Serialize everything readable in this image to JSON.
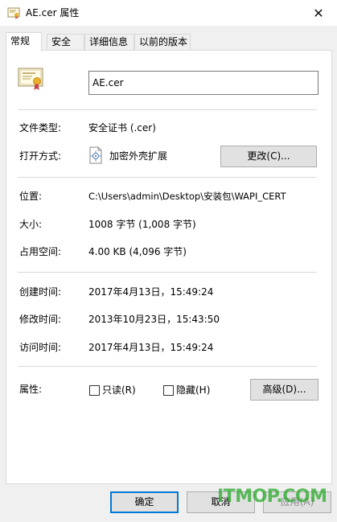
{
  "window": {
    "title": "AE.cer 属性",
    "close_glyph": "✕"
  },
  "tabs": [
    {
      "label": "常规",
      "active": true
    },
    {
      "label": "安全",
      "active": false
    },
    {
      "label": "详细信息",
      "active": false
    },
    {
      "label": "以前的版本",
      "active": false
    }
  ],
  "general": {
    "filename": "AE.cer",
    "file_type_label": "文件类型:",
    "file_type_value": "安全证书 (.cer)",
    "open_with_label": "打开方式:",
    "open_with_value": "加密外壳扩展",
    "change_button": "更改(C)...",
    "location_label": "位置:",
    "location_value": "C:\\Users\\admin\\Desktop\\安装包\\WAPI_CERT",
    "size_label": "大小:",
    "size_value": "1008 字节 (1,008 字节)",
    "size_on_disk_label": "占用空间:",
    "size_on_disk_value": "4.00 KB (4,096 字节)",
    "created_label": "创建时间:",
    "created_value": "2017年4月13日，15:49:24",
    "modified_label": "修改时间:",
    "modified_value": "2013年10月23日，15:43:50",
    "accessed_label": "访问时间:",
    "accessed_value": "2017年4月13日，15:49:24",
    "attributes_label": "属性:",
    "readonly_label": "只读(R)",
    "readonly_checked": false,
    "hidden_label": "隐藏(H)",
    "hidden_checked": false,
    "advanced_button": "高级(D)..."
  },
  "footer": {
    "ok_button": "确定",
    "cancel_button": "取消",
    "apply_button": "应用(A)"
  },
  "watermark": "ITMOP.COM",
  "colors": {
    "focus_border": "#0078d7",
    "watermark": "#28aa28"
  }
}
